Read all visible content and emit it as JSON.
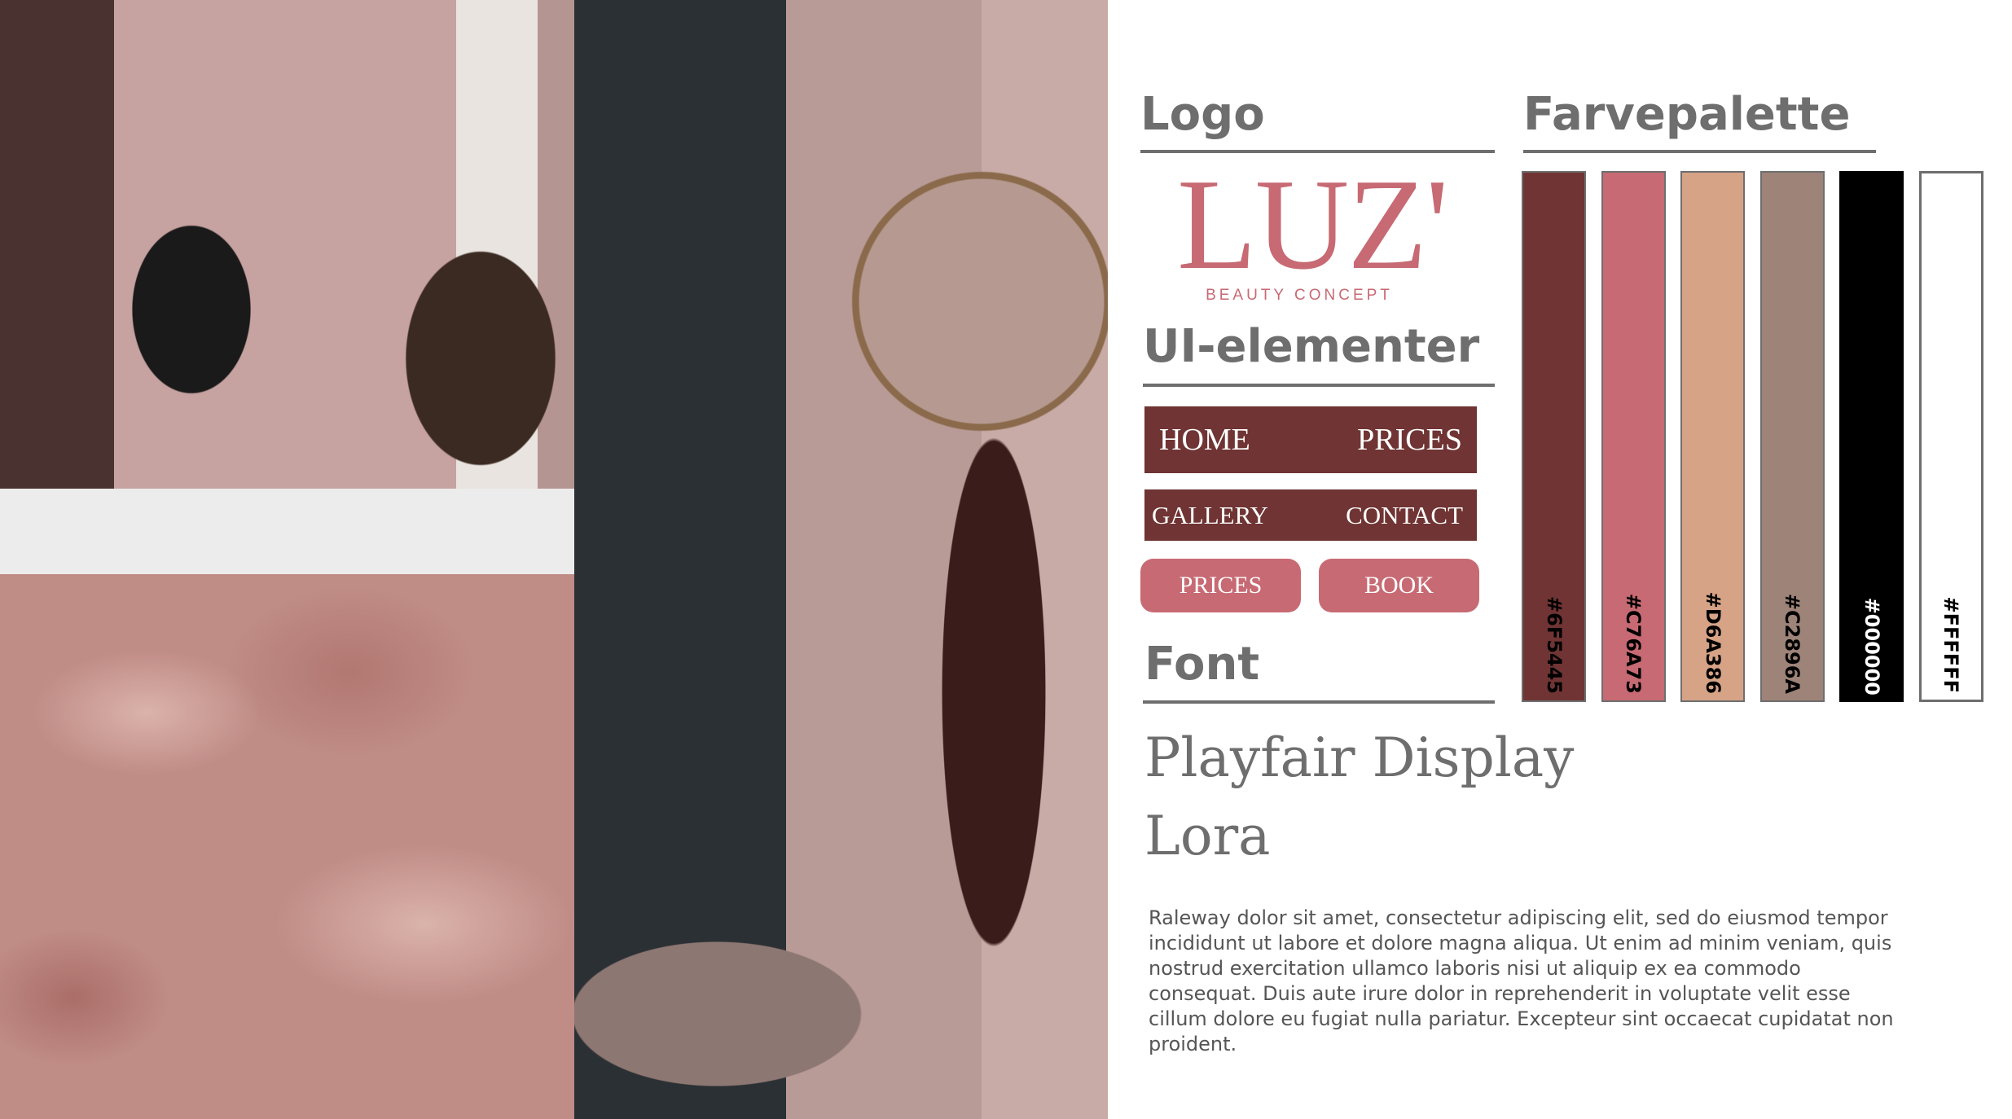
{
  "sections": {
    "logo": "Logo",
    "ui": "UI-elementer",
    "font": "Font",
    "palette": "Farvepalette"
  },
  "logo": {
    "wordmark": "LUZ'",
    "tagline": "BEAUTY CONCEPT"
  },
  "ui_elements": {
    "nav1": {
      "left": "HOME",
      "right": "PRICES"
    },
    "nav2": {
      "left": "GALLERY",
      "right": "CONTACT"
    },
    "buttons": {
      "prices": "PRICES",
      "book": "BOOK"
    }
  },
  "fonts": {
    "display": "Playfair Display",
    "serif": "Lora",
    "body_sample": "Raleway dolor sit amet, consectetur adipiscing elit, sed do eiusmod tempor incididunt ut labore et dolore magna aliqua. Ut enim ad minim veniam, quis nostrud exercitation ullamco laboris nisi ut aliquip ex ea commodo consequat. Duis aute irure dolor in reprehenderit in voluptate velit esse cillum dolore eu fugiat nulla pariatur. Excepteur sint occaecat cupidatat non proident."
  },
  "palette": [
    {
      "hex": "#6F5445",
      "fill": "#6F3433",
      "text": "#000000"
    },
    {
      "hex": "#C76A73",
      "fill": "#C76A73",
      "text": "#000000"
    },
    {
      "hex": "#D6A386",
      "fill": "#D6A386",
      "text": "#000000"
    },
    {
      "hex": "#C2896A",
      "fill": "#9E8378",
      "text": "#000000"
    },
    {
      "hex": "#000000",
      "fill": "#000000",
      "text": "#ffffff"
    },
    {
      "hex": "#FFFFFF",
      "fill": "#FFFFFF",
      "text": "#000000"
    }
  ]
}
